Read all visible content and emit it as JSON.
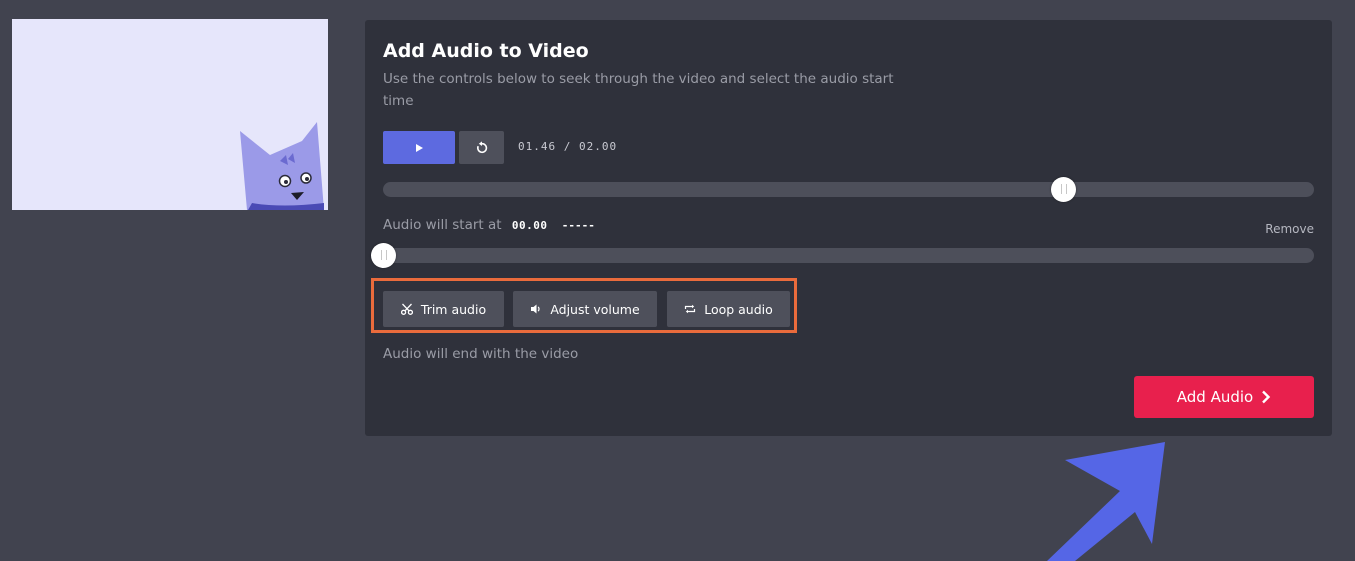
{
  "preview": {
    "icon": "cat-mascot-icon",
    "background_color": "#e6e6fb"
  },
  "panel": {
    "title": "Add Audio to Video",
    "subtitle": "Use the controls below to seek through the video and select the audio start time"
  },
  "player": {
    "play_icon": "play-icon",
    "replay_icon": "replay-icon",
    "current_time": "01.46",
    "duration": "02.00",
    "time_separator": " / ",
    "seek_fraction": 0.73
  },
  "audio_start": {
    "label": "Audio will start at",
    "value": "00.00",
    "dashes": "-----",
    "remove_label": "Remove",
    "start_fraction": 0.0
  },
  "tools": [
    {
      "label": "Trim audio",
      "icon": "scissors-icon"
    },
    {
      "label": "Adjust volume",
      "icon": "speaker-icon"
    },
    {
      "label": "Loop audio",
      "icon": "loop-icon"
    }
  ],
  "end_note": "Audio will end with the video",
  "primary_action": {
    "label": "Add Audio",
    "icon": "chevron-right-icon",
    "color": "#e8204d"
  },
  "annotation": {
    "icon": "arrow-up-right-icon",
    "color": "#5566e6",
    "highlight_color": "#ea6b3c"
  },
  "colors": {
    "accent": "#5d6ae0",
    "panel_bg": "#2f313b",
    "page_bg": "#41434f"
  }
}
